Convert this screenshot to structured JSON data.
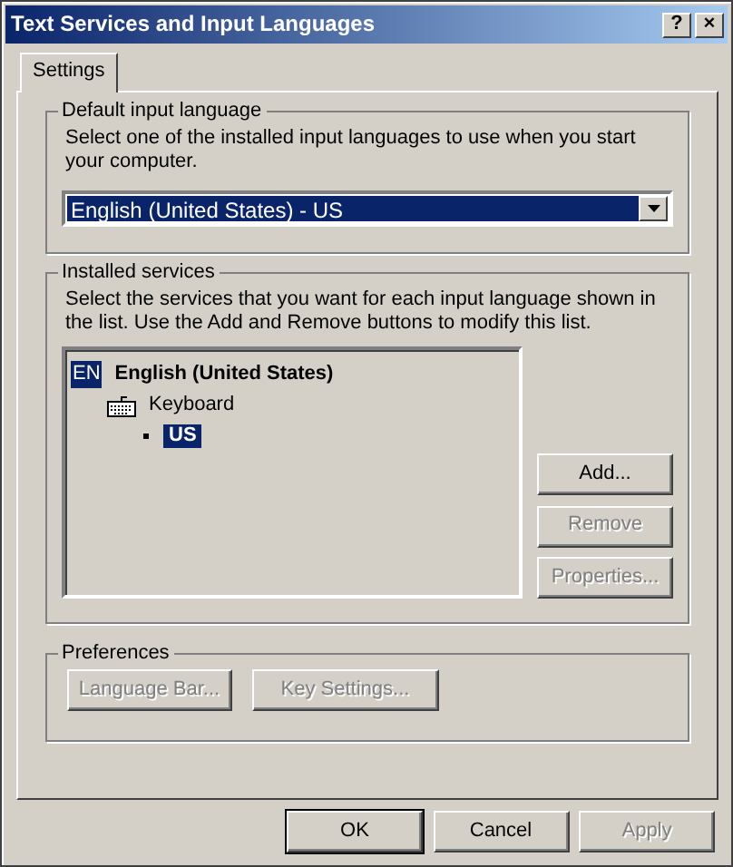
{
  "window": {
    "title": "Text Services and Input Languages",
    "title_buttons": [
      "?",
      "×"
    ]
  },
  "tabs": [
    {
      "label": "Settings",
      "selected": true
    }
  ],
  "default_language": {
    "legend": "Default input language",
    "description": "Select one of the installed input languages to use when you start your computer.",
    "value": "English (United States) - US"
  },
  "installed_services": {
    "legend": "Installed services",
    "description": "Select the services that you want for each input language shown in the list. Use the Add and Remove buttons to modify this list.",
    "tree": [
      {
        "badge": "EN",
        "label": "English (United States)",
        "selected": false,
        "children": [
          {
            "label": "Keyboard",
            "selected": false,
            "children": [
              {
                "label": "US",
                "selected": true
              }
            ]
          }
        ]
      }
    ],
    "buttons": [
      {
        "label": "Add...",
        "disabled": false
      },
      {
        "label": "Remove",
        "disabled": true
      },
      {
        "label": "Properties...",
        "disabled": true
      }
    ]
  },
  "preferences": {
    "legend": "Preferences",
    "buttons": [
      {
        "label": "Language Bar...",
        "disabled": true
      },
      {
        "label": "Key Settings...",
        "disabled": true
      }
    ]
  },
  "dialog_buttons": [
    {
      "label": "OK",
      "disabled": false,
      "default": true
    },
    {
      "label": "Cancel",
      "disabled": false,
      "default": false
    },
    {
      "label": "Apply",
      "disabled": true,
      "default": false
    }
  ]
}
